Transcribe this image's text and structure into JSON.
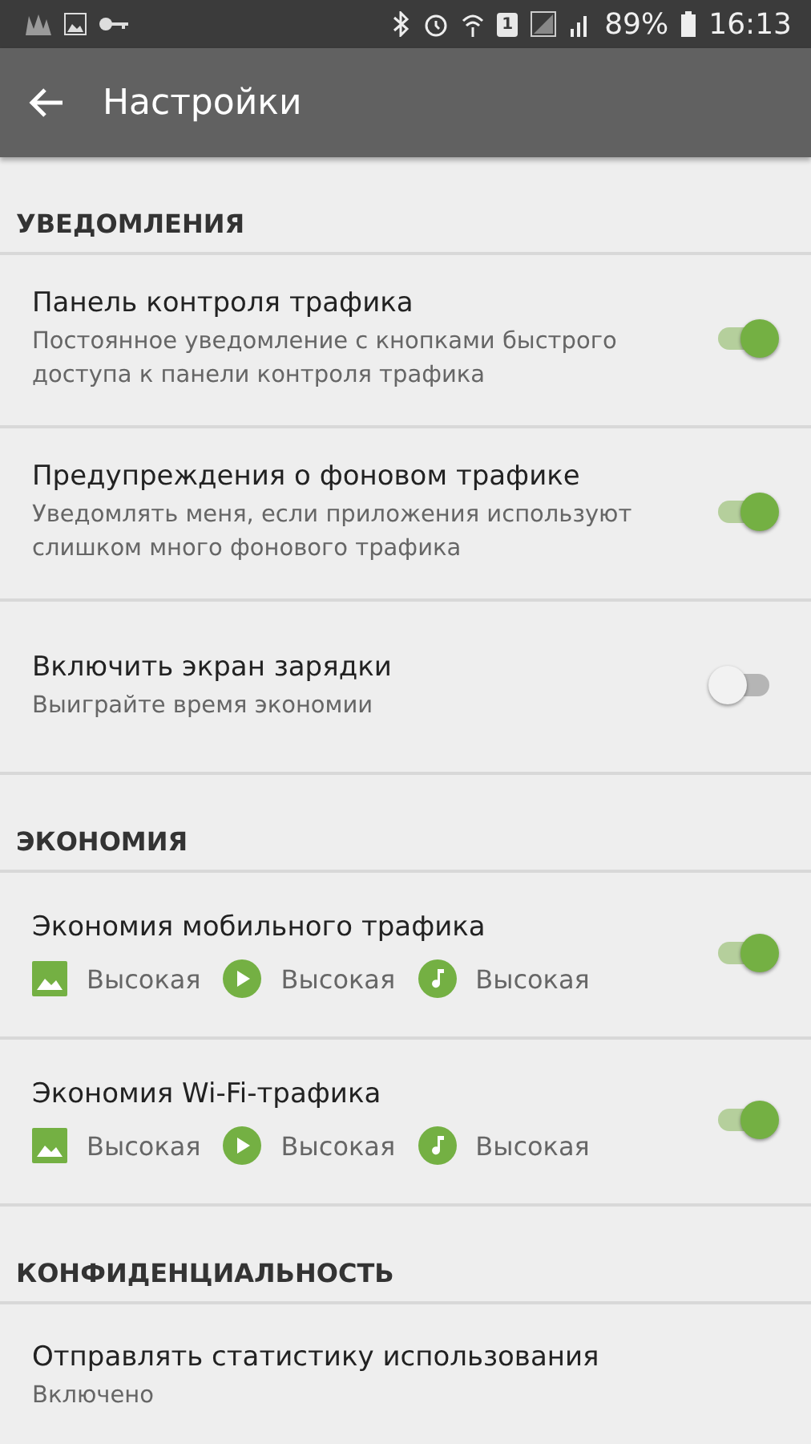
{
  "status_bar": {
    "sim": "1",
    "battery": "89%",
    "time": "16:13"
  },
  "app_bar": {
    "title": "Настройки"
  },
  "sections": [
    {
      "header": "УВЕДОМЛЕНИЯ",
      "items": [
        {
          "kind": "toggle",
          "title": "Панель контроля трафика",
          "subtitle": "Постоянное уведомление с кнопками быстрого доступа к панели контроля трафика",
          "on": true
        },
        {
          "kind": "toggle",
          "title": "Предупреждения о фоновом трафике",
          "subtitle": "Уведомлять меня, если приложения используют слишком много фонового трафика",
          "on": true
        },
        {
          "kind": "toggle",
          "title": "Включить экран зарядки",
          "subtitle": "Выиграйте время экономии",
          "on": false
        }
      ]
    },
    {
      "header": "ЭКОНОМИЯ",
      "items": [
        {
          "kind": "economy",
          "title": "Экономия мобильного трафика",
          "on": true,
          "levels": [
            {
              "kind": "image",
              "label": "Высокая"
            },
            {
              "kind": "video",
              "label": "Высокая"
            },
            {
              "kind": "music",
              "label": "Высокая"
            }
          ]
        },
        {
          "kind": "economy",
          "title": "Экономия Wi-Fi-трафика",
          "on": true,
          "levels": [
            {
              "kind": "image",
              "label": "Высокая"
            },
            {
              "kind": "video",
              "label": "Высокая"
            },
            {
              "kind": "music",
              "label": "Высокая"
            }
          ]
        }
      ]
    },
    {
      "header": "КОНФИДЕНЦИАЛЬНОСТЬ",
      "items": [
        {
          "kind": "plain",
          "title": "Отправлять статистику использования",
          "subtitle": "Включено"
        }
      ]
    }
  ]
}
